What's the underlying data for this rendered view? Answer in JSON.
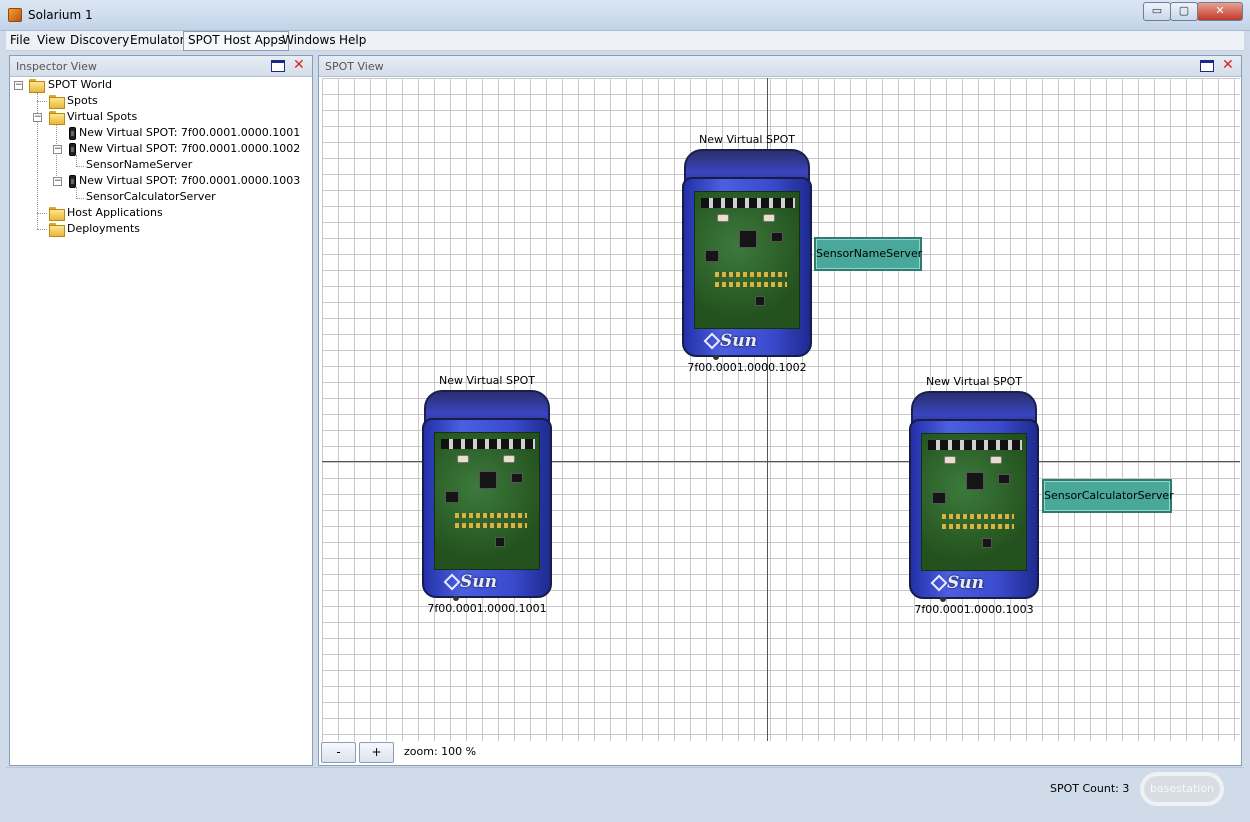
{
  "window": {
    "title": "Solarium 1",
    "minimize": "▭",
    "maximize": "▢",
    "close": "✕"
  },
  "menu": [
    "File",
    "View",
    "Discovery",
    "Emulator",
    "SPOT Host Apps",
    "Windows",
    "Help"
  ],
  "inspector": {
    "title": "Inspector View",
    "tree": {
      "root": "SPOT World",
      "spots": "Spots",
      "virtual_spots": "Virtual Spots",
      "spot1": "New Virtual SPOT: 7f00.0001.0000.1001",
      "spot2": "New Virtual SPOT: 7f00.0001.0000.1002",
      "spot2_app": "SensorNameServer",
      "spot3": "New Virtual SPOT: 7f00.0001.0000.1003",
      "spot3_app": "SensorCalculatorServer",
      "host_apps": "Host Applications",
      "deployments": "Deployments"
    }
  },
  "spotview": {
    "title": "SPOT View",
    "devices": [
      {
        "label": "New Virtual SPOT",
        "address": "7f00.0001.0000.1002",
        "app": "SensorNameServer"
      },
      {
        "label": "New Virtual SPOT",
        "address": "7f00.0001.0000.1001",
        "app": ""
      },
      {
        "label": "New Virtual SPOT",
        "address": "7f00.0001.0000.1003",
        "app": "SensorCalculatorServer"
      }
    ],
    "logo": "Sun",
    "zoom_out": "-",
    "zoom_in": "+",
    "zoom": "zoom: 100 %"
  },
  "status": {
    "spot_count": "SPOT Count: 3",
    "basestation": "basestation"
  }
}
